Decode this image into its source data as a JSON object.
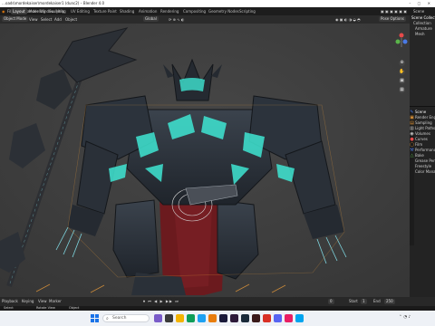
{
  "window": {
    "title": "…oads\\mordekaiser\\mordekaiser1 (dunc2) – Blender 4.0",
    "controls": "– ▢ ✕"
  },
  "menubar": {
    "menus": [
      "File",
      "Edit",
      "Render",
      "Window",
      "Help"
    ],
    "tabs": [
      "Layout",
      "Modeling",
      "Sculpting",
      "UV Editing",
      "Texture Paint",
      "Shading",
      "Animation",
      "Rendering",
      "Compositing",
      "Geometry Nodes",
      "Scripting"
    ],
    "active_tab": "Layout",
    "scene_label": "Scene"
  },
  "viewport_header": {
    "mode": "Object Mode",
    "menus": [
      "View",
      "Select",
      "Add",
      "Object"
    ],
    "orientation": "Global",
    "pivot": "Pose Options"
  },
  "right_panel": {
    "outliner_title": "Scene Collection",
    "outliner_items": [
      "Collection",
      "Armature",
      "Mesh"
    ],
    "properties_title": "Scene",
    "properties_rows": [
      "Render Engine",
      "Sampling",
      "Light Paths",
      "Volumes",
      "Curves",
      "Film",
      "Performance",
      "Bake",
      "Grease Pencil",
      "Freestyle",
      "Color Management"
    ]
  },
  "timeline": {
    "playback": "Playback",
    "keying": "Keying",
    "view": "View",
    "marker": "Marker",
    "current_frame": "0",
    "start_label": "Start",
    "start": "1",
    "end_label": "End",
    "end": "250"
  },
  "statusbar": {
    "left": "Select",
    "middle": "Rotate View",
    "right": "Object"
  },
  "taskbar": {
    "search_placeholder": "Search",
    "colors": {
      "accent": "#1a73e8",
      "blender": "#e87d0d"
    }
  },
  "theme": {
    "teal_glow": "#3fe6d3",
    "armor": "#2a3038",
    "cloth_red": "#6b1a1e",
    "outline_orange": "#e89a3a"
  }
}
